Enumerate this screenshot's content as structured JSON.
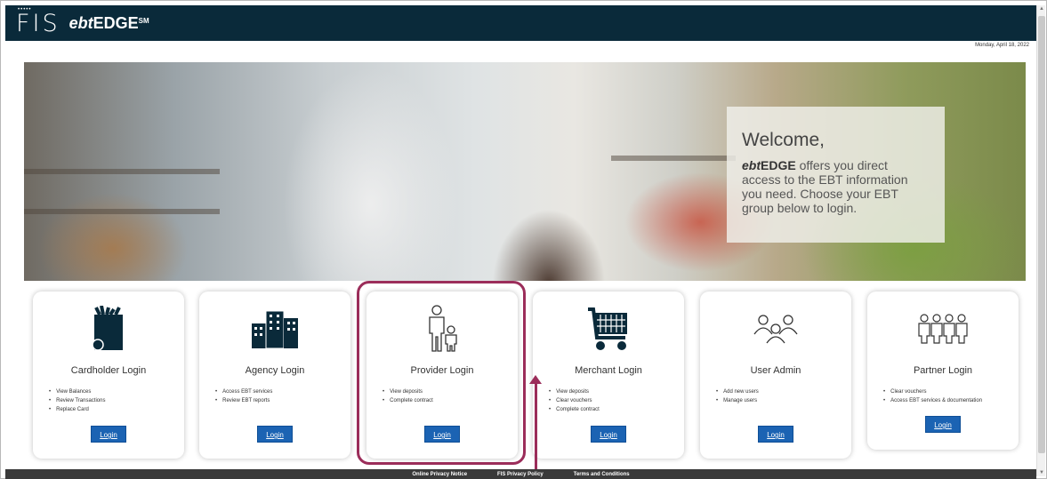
{
  "header": {
    "logo_fis": "FIS",
    "brand_prefix": "ebt",
    "brand_main": "EDGE",
    "brand_sup": "SM"
  },
  "date": "Monday, April 18, 2022",
  "hero": {
    "welcome_title": "Welcome,",
    "ebt_prefix": "ebt",
    "ebt_main": "EDGE",
    "welcome_text1": " offers you direct access to the EBT information you need. ",
    "welcome_text2": "Choose your EBT group below to login."
  },
  "cards": [
    {
      "title": "Cardholder Login",
      "items": [
        "View Balances",
        "Review Transactions",
        "Replace Card"
      ],
      "button": "Login",
      "icon": "grocery-bag-icon"
    },
    {
      "title": "Agency Login",
      "items": [
        "Access EBT services",
        "Review EBT reports"
      ],
      "button": "Login",
      "icon": "buildings-icon"
    },
    {
      "title": "Provider Login",
      "items": [
        "View deposits",
        "Complete contract"
      ],
      "button": "Login",
      "icon": "adult-child-icon"
    },
    {
      "title": "Merchant Login",
      "items": [
        "View deposits",
        "Clear vouchers",
        "Complete contract"
      ],
      "button": "Login",
      "icon": "shopping-cart-icon"
    },
    {
      "title": "User Admin",
      "items": [
        "Add new users",
        "Manage users"
      ],
      "button": "Login",
      "icon": "users-icon"
    },
    {
      "title": "Partner Login",
      "items": [
        "Clear vouchers",
        "Access EBT services & documentation"
      ],
      "button": "Login",
      "icon": "partners-icon"
    }
  ],
  "footer": {
    "links": [
      "Online Privacy Notice",
      "FIS Privacy Policy",
      "Terms and Conditions"
    ]
  },
  "colors": {
    "header_bg": "#0a2a3a",
    "button_bg": "#1b63b3",
    "highlight": "#9b2d5a"
  }
}
